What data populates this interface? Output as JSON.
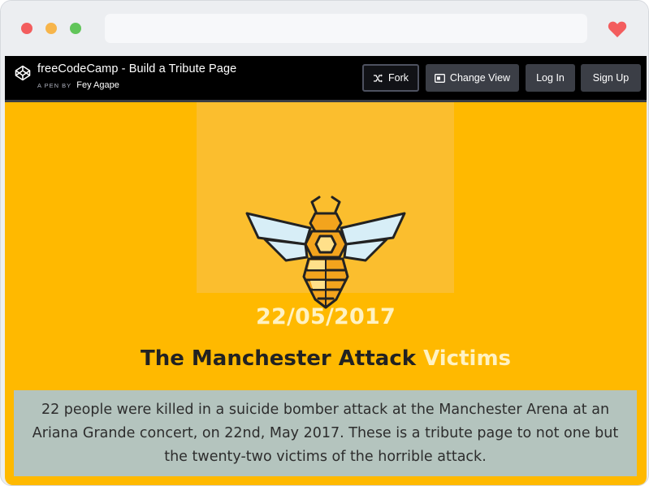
{
  "browser": {
    "traffic_lights": [
      "close",
      "minimize",
      "maximize"
    ],
    "heart_icon": "heart-icon",
    "heart_color": "#f35d5e"
  },
  "codepen_header": {
    "title": "freeCodeCamp - Build a Tribute Page",
    "byline_prefix": "A PEN BY",
    "author": "Fey Agape",
    "buttons": {
      "fork": "Fork",
      "change_view": "Change View",
      "log_in": "Log In",
      "sign_up": "Sign Up"
    }
  },
  "tribute": {
    "date": "22/05/2017",
    "headline_main": "The Manchester Attack",
    "headline_accent": "Victims",
    "caption": "22 people were killed in a suicide bomber attack at the Manchester Arena at an Ariana Grande concert, on 22nd, May 2017. These is a tribute page to not one but the twenty-two victims of the horrible attack."
  },
  "colors": {
    "page_background": "#FFB900",
    "hero_box": "#FBBE2E",
    "accent_text": "#FFF2C2",
    "caption_background": "#B4C4BE",
    "header_background": "#000000"
  }
}
